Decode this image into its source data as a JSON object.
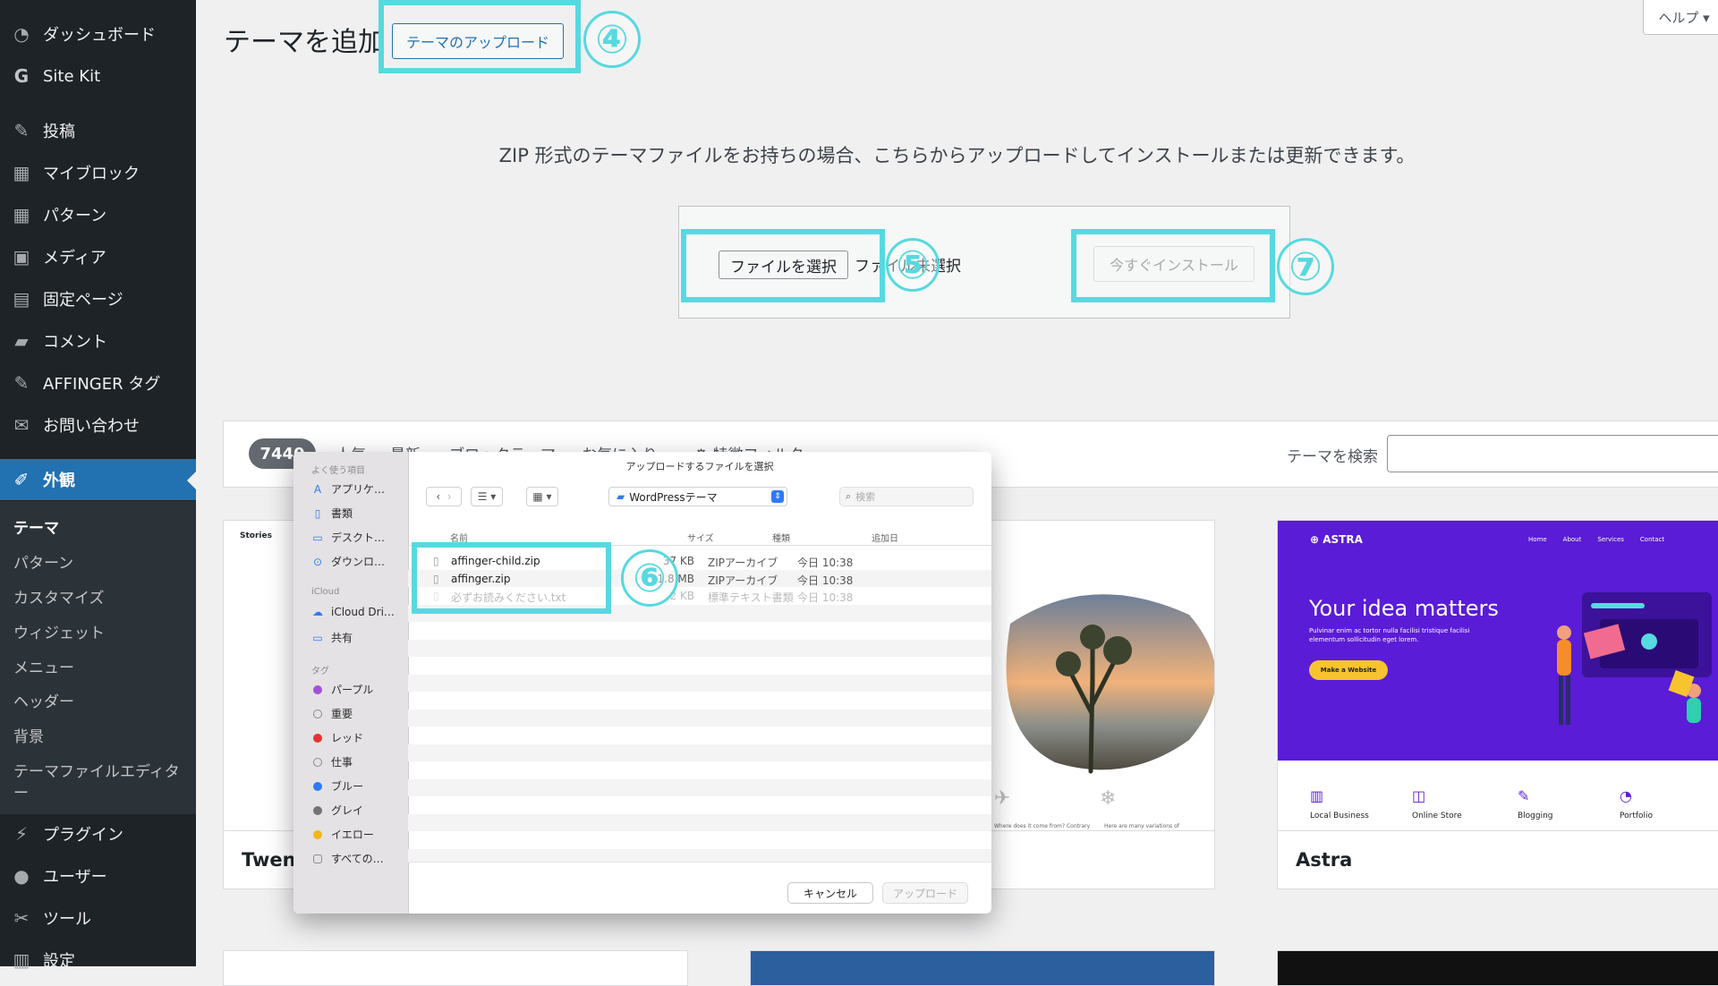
{
  "sidebar": {
    "items": [
      {
        "name": "dashboard",
        "label": "ダッシュボード",
        "icon": "dashboard-icon",
        "glyph": "◔"
      },
      {
        "name": "site-kit",
        "label": "Site Kit",
        "icon": "google-g-icon",
        "glyph": "G"
      },
      {
        "name": "posts",
        "label": "投稿",
        "icon": "pushpin-icon",
        "glyph": "✎"
      },
      {
        "name": "my-blocks",
        "label": "マイブロック",
        "icon": "grid-icon",
        "glyph": "▦"
      },
      {
        "name": "patterns",
        "label": "パターン",
        "icon": "grid-icon",
        "glyph": "▦"
      },
      {
        "name": "media",
        "label": "メディア",
        "icon": "media-icon",
        "glyph": "▣"
      },
      {
        "name": "pages",
        "label": "固定ページ",
        "icon": "pages-icon",
        "glyph": "▤"
      },
      {
        "name": "comments",
        "label": "コメント",
        "icon": "comment-icon",
        "glyph": "▰"
      },
      {
        "name": "affinger-tag",
        "label": "AFFINGER タグ",
        "icon": "pushpin-icon",
        "glyph": "✎"
      },
      {
        "name": "contact",
        "label": "お問い合わせ",
        "icon": "mail-icon",
        "glyph": "✉"
      },
      {
        "name": "appearance",
        "label": "外観",
        "icon": "paintbrush-icon",
        "glyph": "✐"
      },
      {
        "name": "plugins",
        "label": "プラグイン",
        "icon": "plugin-icon",
        "glyph": "⚡"
      },
      {
        "name": "users",
        "label": "ユーザー",
        "icon": "user-icon",
        "glyph": "●"
      },
      {
        "name": "tools",
        "label": "ツール",
        "icon": "wrench-icon",
        "glyph": "✂"
      },
      {
        "name": "settings",
        "label": "設定",
        "icon": "settings-icon",
        "glyph": "▥"
      }
    ],
    "submenu": [
      "テーマ",
      "パターン",
      "カスタマイズ",
      "ウィジェット",
      "メニュー",
      "ヘッダー",
      "背景",
      "テーマファイルエディタ",
      "ー"
    ]
  },
  "header": {
    "title": "テーマを追加",
    "upload_button": "テーマのアップロード",
    "help": "ヘルプ ▾"
  },
  "steps": [
    "④",
    "⑤",
    "⑥",
    "⑦"
  ],
  "upload": {
    "description": "ZIP 形式のテーマファイルをお持ちの場合、こちらからアップロードしてインストールまたは更新できます。",
    "choose_file": "ファイルを選択",
    "no_file": "ファイル未選択",
    "install_now": "今すぐインストール"
  },
  "filter": {
    "count": "7440",
    "tabs": [
      "人気",
      "最新",
      "ブロックテーマ",
      "お気に入り",
      "特徴フィルター"
    ],
    "search_label": "テーマを検索"
  },
  "themes": [
    {
      "name": "Twent",
      "thumb_label": "Stories"
    },
    {
      "name": "",
      "captions": [
        "Where does it come from? Contrary",
        "Here are many variations of"
      ]
    },
    {
      "name": "Astra",
      "brand": "ASTRA",
      "nav": [
        "Home",
        "About",
        "Services",
        "Contact"
      ],
      "headline": "Your idea matters",
      "body": "Pulvinar enim ac tortor nulla facilisi tristique facilisi elementum sollicitudin eget lorem.",
      "cta": "Make a Website",
      "features": [
        "Local Business",
        "Online Store",
        "Blogging",
        "Portfolio"
      ]
    }
  ],
  "dialog": {
    "title": "アップロードするファイルを選択",
    "folder": "WordPressテーマ",
    "search_placeholder": "検索",
    "sidebar": {
      "favorites_label": "よく使う項目",
      "favorites": [
        {
          "label": "アプリケ…",
          "glyph": "A",
          "icon": "applications-icon"
        },
        {
          "label": "書類",
          "glyph": "▯",
          "icon": "document-icon"
        },
        {
          "label": "デスクト…",
          "glyph": "▭",
          "icon": "desktop-icon"
        },
        {
          "label": "ダウンロ…",
          "glyph": "⊙",
          "icon": "download-icon"
        }
      ],
      "icloud_label": "iCloud",
      "icloud": [
        {
          "label": "iCloud Dri…",
          "glyph": "☁",
          "icon": "cloud-icon"
        },
        {
          "label": "共有",
          "glyph": "▭",
          "icon": "shared-folder-icon"
        }
      ],
      "tags_label": "タグ",
      "tags": [
        {
          "label": "パープル",
          "color": "#a550d8",
          "filled": true
        },
        {
          "label": "重要",
          "color": "#8b8b8b",
          "filled": false
        },
        {
          "label": "レッド",
          "color": "#e9322f",
          "filled": true
        },
        {
          "label": "仕事",
          "color": "#8b8b8b",
          "filled": false
        },
        {
          "label": "ブルー",
          "color": "#2f7bf5",
          "filled": true
        },
        {
          "label": "グレイ",
          "color": "#737373",
          "filled": true
        },
        {
          "label": "イエロー",
          "color": "#f3b71b",
          "filled": true
        },
        {
          "label": "すべての…",
          "color": "#8b8b8b",
          "filled": false
        }
      ]
    },
    "columns": [
      "名前",
      "サイズ",
      "種類",
      "追加日"
    ],
    "files": [
      {
        "name": "affinger-child.zip",
        "size": "37 KB",
        "kind": "ZIPアーカイブ",
        "date": "今日 10:38",
        "disabled": false
      },
      {
        "name": "affinger.zip",
        "size": "1.8 MB",
        "kind": "ZIPアーカイブ",
        "date": "今日 10:38",
        "disabled": false
      },
      {
        "name": "必ずお読みください.txt",
        "size": "2 KB",
        "kind": "標準テキスト書類",
        "date": "今日 10:38",
        "disabled": true
      }
    ],
    "cancel": "キャンセル",
    "upload": "アップロード"
  },
  "colors": {
    "accent": "#2271b1",
    "highlight": "#56d9e0",
    "sidebar": "#1d2327",
    "astra": "#5a1cd6"
  }
}
